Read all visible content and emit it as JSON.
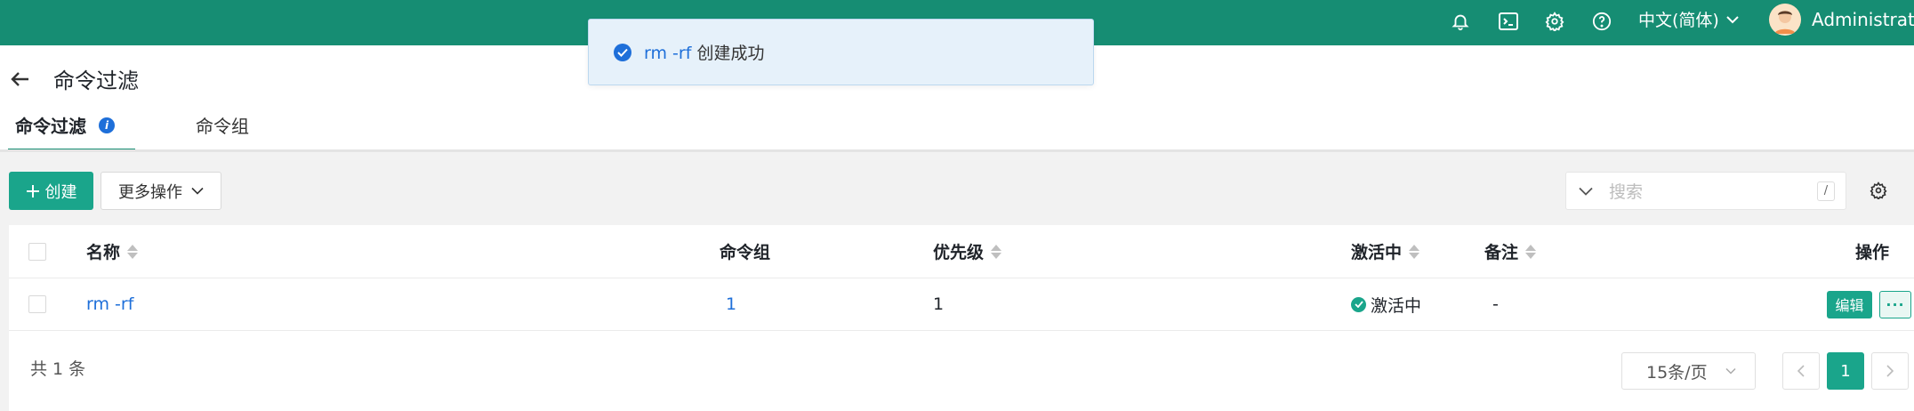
{
  "header": {
    "language": "中文(简体)",
    "username": "Administrator",
    "icons": [
      "bell-icon",
      "terminal-icon",
      "gear-icon",
      "help-icon"
    ]
  },
  "page": {
    "title": "命令过滤",
    "tabs": [
      {
        "label": "命令过滤",
        "active": true
      },
      {
        "label": "命令组",
        "active": false
      }
    ]
  },
  "toast": {
    "name": "rm -rf",
    "message": "创建成功"
  },
  "toolbar": {
    "create_label": "创建",
    "more_label": "更多操作",
    "search_placeholder": "搜索",
    "search_shortcut": "/"
  },
  "table": {
    "columns": [
      "名称",
      "命令组",
      "优先级",
      "激活中",
      "备注",
      "操作"
    ],
    "rows": [
      {
        "name": "rm -rf",
        "command_group": "1",
        "priority": "1",
        "active": "激活中",
        "comment": "-",
        "edit_label": "编辑"
      }
    ]
  },
  "footer": {
    "total": "共 1 条",
    "page_size": "15条/页",
    "current_page": "1"
  },
  "colors": {
    "brand": "#168d73",
    "accent": "#1aa58b",
    "link": "#1e6fd9"
  }
}
